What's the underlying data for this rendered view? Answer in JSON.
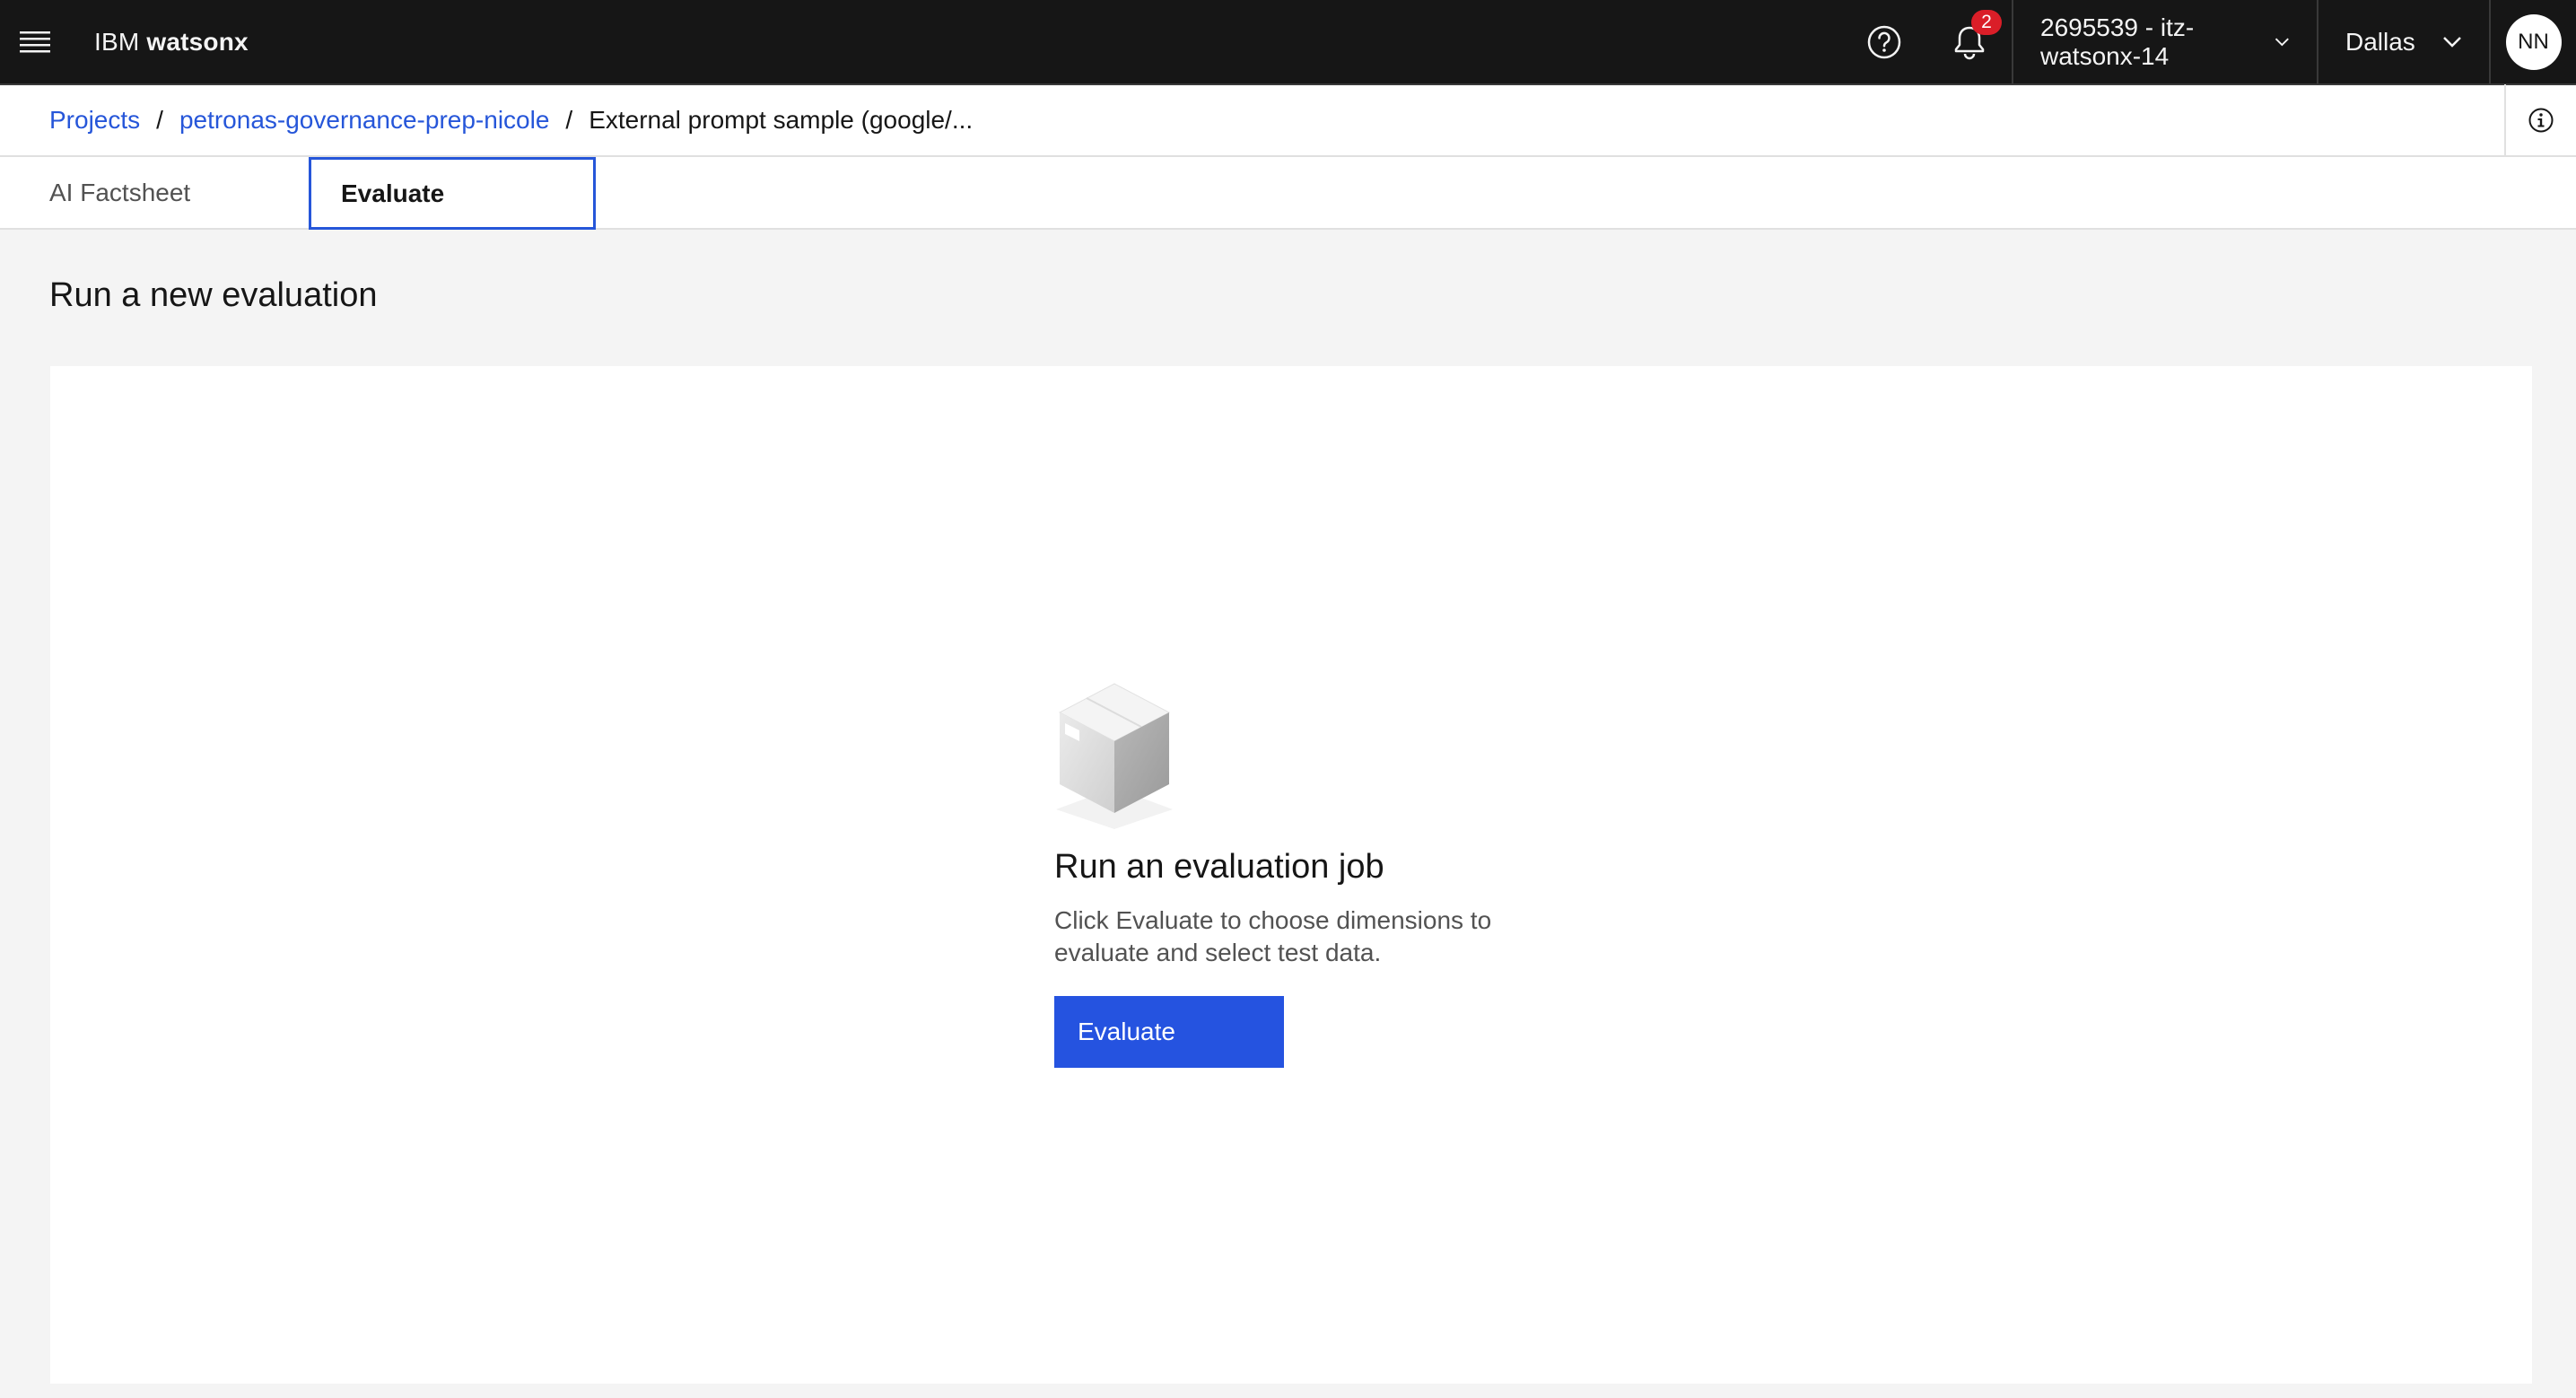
{
  "header": {
    "brand_prefix": "IBM",
    "brand_name": "watsonx",
    "notification_count": "2",
    "account": "2695539 - itz-watsonx-14",
    "region": "Dallas",
    "avatar_initials": "NN"
  },
  "breadcrumb": {
    "items": [
      "Projects",
      "petronas-governance-prep-nicole"
    ],
    "separator": "/",
    "current": "External prompt sample (google/..."
  },
  "tabs": [
    {
      "label": "AI Factsheet",
      "selected": false
    },
    {
      "label": "Evaluate",
      "selected": true
    }
  ],
  "main": {
    "title": "Run a new evaluation",
    "empty_state": {
      "title": "Run an evaluation job",
      "description": "Click Evaluate to choose dimensions to evaluate and select test data.",
      "button_label": "Evaluate"
    }
  },
  "colors": {
    "header_bg": "#161616",
    "link": "#2656d9",
    "primary_button": "#2553e0",
    "badge": "#da1e28"
  }
}
